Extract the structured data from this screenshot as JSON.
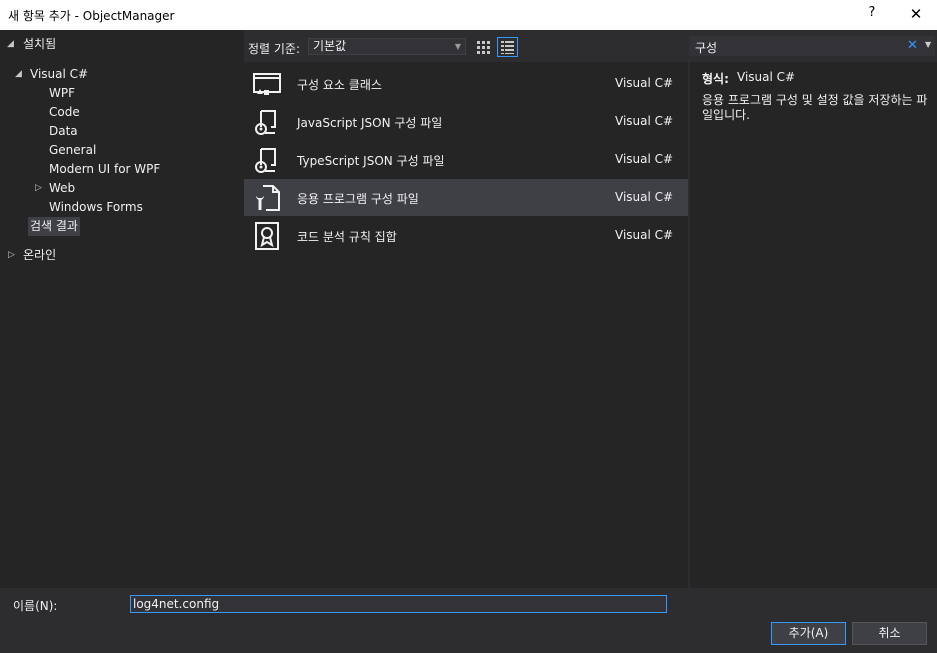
{
  "window": {
    "title": "새 항목 추가 - ObjectManager",
    "help": "?",
    "close": "✕"
  },
  "tree": {
    "installed": "설치됨",
    "visual_csharp": "Visual C#",
    "children": [
      "WPF",
      "Code",
      "Data",
      "General",
      "Modern UI for WPF",
      "Web",
      "Windows Forms"
    ],
    "search_results": "검색 결과",
    "online": "온라인"
  },
  "sort": {
    "label": "정렬 기준:",
    "value": "기본값"
  },
  "items": [
    {
      "name": "구성 요소 클래스",
      "lang": "Visual C#",
      "icon": "component-class-icon"
    },
    {
      "name": "JavaScript JSON 구성 파일",
      "lang": "Visual C#",
      "icon": "json-config-icon"
    },
    {
      "name": "TypeScript JSON 구성 파일",
      "lang": "Visual C#",
      "icon": "json-config-icon"
    },
    {
      "name": "응용 프로그램 구성 파일",
      "lang": "Visual C#",
      "icon": "app-config-icon",
      "selected": true
    },
    {
      "name": "코드 분석 규칙 집합",
      "lang": "Visual C#",
      "icon": "ruleset-icon"
    }
  ],
  "search": {
    "query": "구성"
  },
  "info": {
    "type_label": "형식:",
    "type_value": "Visual C#",
    "description": "응용 프로그램 구성 및 설정 값을 저장하는 파일입니다."
  },
  "name_field": {
    "label": "이름(N):",
    "value": "log4net.config"
  },
  "buttons": {
    "add": "추가(A)",
    "cancel": "취소"
  },
  "colors": {
    "accent": "#3399ff",
    "background": "#2d2d30",
    "pane": "#252526",
    "selection": "#3f3f46"
  }
}
